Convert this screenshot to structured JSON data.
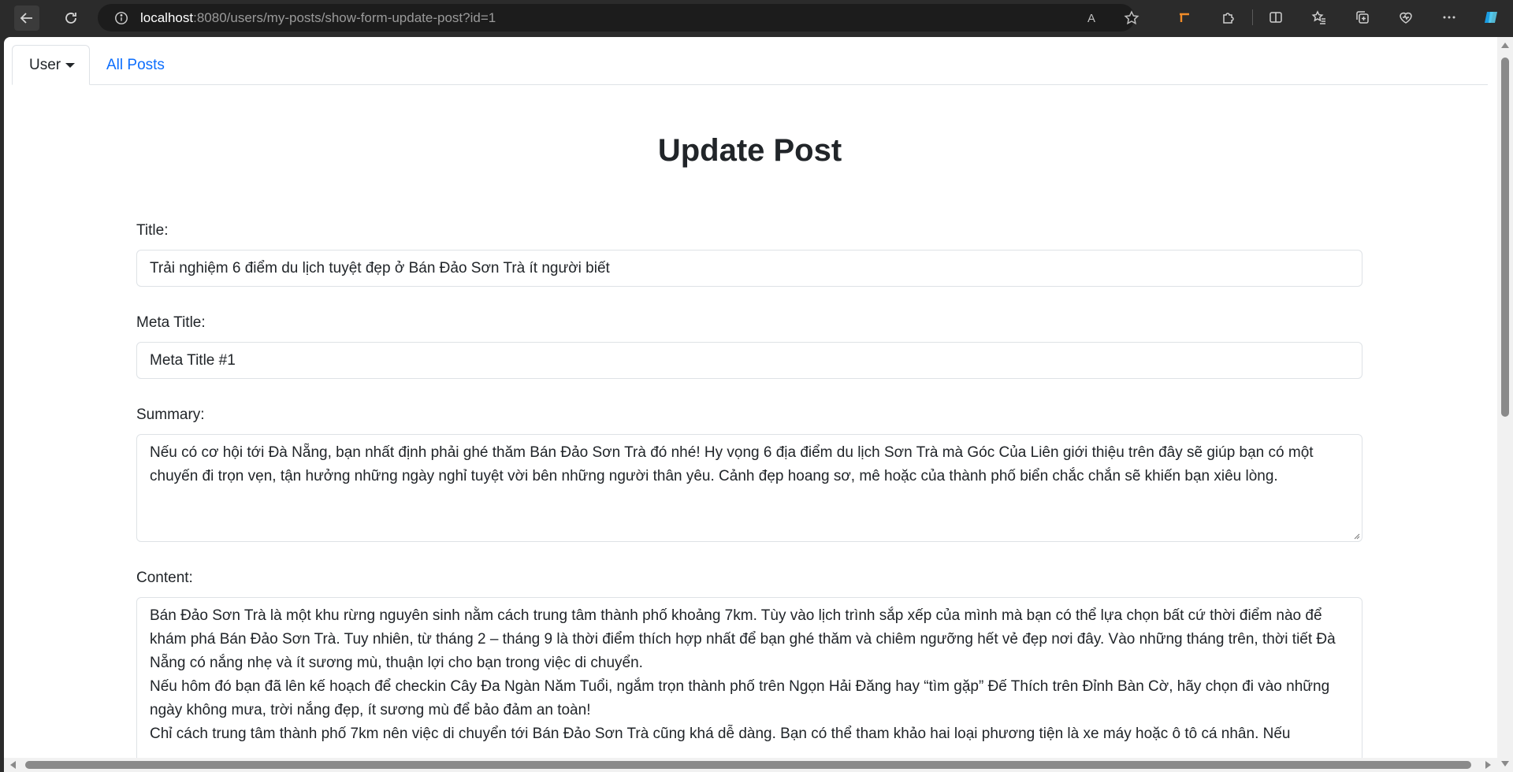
{
  "browser": {
    "url_host": "localhost",
    "url_rest": ":8080/users/my-posts/show-form-update-post?id=1",
    "read_aloud_label": "A",
    "accent_orange": "#f28c28",
    "accent_copilot": "#1b9de2"
  },
  "nav": {
    "user_label": "User",
    "all_posts_label": "All Posts",
    "link_color": "#0d6efd"
  },
  "form": {
    "heading": "Update Post",
    "title_label": "Title:",
    "title_value": "Trải nghiệm 6 điểm du lịch tuyệt đẹp ở Bán Đảo Sơn Trà ít người biết",
    "meta_title_label": "Meta Title:",
    "meta_title_value": "Meta Title #1",
    "summary_label": "Summary:",
    "summary_value": "Nếu có cơ hội tới Đà Nẵng, bạn nhất định phải ghé thăm Bán Đảo Sơn Trà đó nhé! Hy vọng 6 địa điểm du lịch Sơn Trà mà Góc Của Liên giới thiệu trên đây sẽ giúp bạn có một chuyến đi trọn vẹn, tận hưởng những ngày nghỉ tuyệt vời bên những người thân yêu. Cảnh đẹp hoang sơ, mê hoặc của thành phố biển chắc chắn sẽ khiến bạn xiêu lòng.",
    "content_label": "Content:",
    "content_value": "Bán Đảo Sơn Trà là một khu rừng nguyên sinh nằm cách trung tâm thành phố khoảng 7km. Tùy vào lịch trình sắp xếp của mình mà bạn có thể lựa chọn bất cứ thời điểm nào để khám phá Bán Đảo Sơn Trà. Tuy nhiên, từ tháng 2 – tháng 9 là thời điểm thích hợp nhất để bạn ghé thăm và chiêm ngưỡng hết vẻ đẹp nơi đây. Vào những tháng trên, thời tiết Đà Nẵng có nắng nhẹ và ít sương mù, thuận lợi cho bạn trong việc di chuyển.\nNếu hôm đó bạn đã lên kế hoạch để checkin Cây Đa Ngàn Năm Tuổi, ngắm trọn thành phố trên Ngọn Hải Đăng hay “tìm gặp” Đế Thích trên Đỉnh Bàn Cờ, hãy chọn đi vào những ngày không mưa, trời nắng đẹp, ít sương mù để bảo đảm an toàn!\nChỉ cách trung tâm thành phố 7km nên việc di chuyển tới Bán Đảo Sơn Trà cũng khá dễ dàng. Bạn có thể tham khảo hai loại phương tiện là xe máy hoặc ô tô cá nhân. Nếu"
  }
}
